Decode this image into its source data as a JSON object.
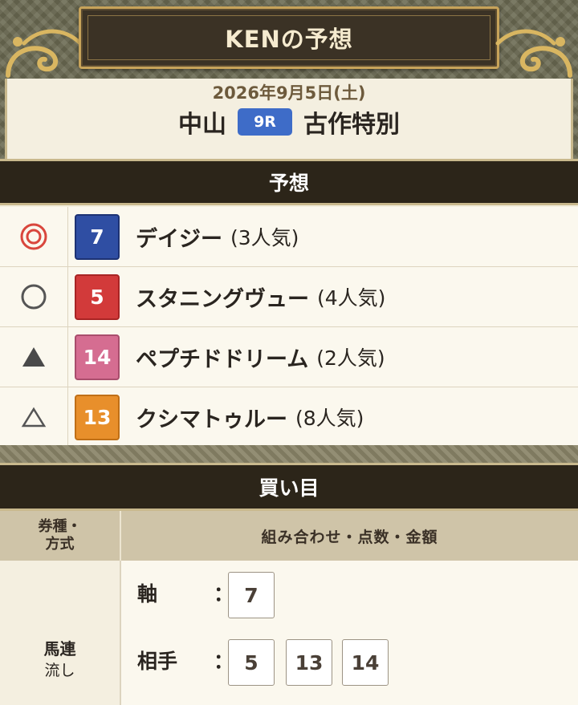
{
  "header": {
    "title": "KENの予想",
    "date": "2026年9月5日(土)",
    "venue": "中山",
    "race_number": "9R",
    "race_name": "古作特別"
  },
  "prediction": {
    "heading": "予想",
    "rows": [
      {
        "mark": "double-circle",
        "number": "7",
        "horse": "デイジー",
        "popularity": "(3人気)",
        "color": "#2f4ea3"
      },
      {
        "mark": "circle",
        "number": "5",
        "horse": "スタニングヴュー",
        "popularity": "(4人気)",
        "color": "#d23a3a"
      },
      {
        "mark": "filled-triangle",
        "number": "14",
        "horse": "ペプチドドリーム",
        "popularity": "(2人気)",
        "color": "#d56d91"
      },
      {
        "mark": "open-triangle",
        "number": "13",
        "horse": "クシマトゥルー",
        "popularity": "(8人気)",
        "color": "#e88f2b"
      }
    ]
  },
  "bets": {
    "heading": "買い目",
    "col1_header_line1": "券種・",
    "col1_header_line2": "方式",
    "col2_header": "組み合わせ・点数・金額",
    "bet_type": "馬連",
    "bet_method": "流し",
    "axis_label": "軸",
    "axis_numbers": [
      "7"
    ],
    "partner_label": "相手",
    "partner_numbers": [
      "5",
      "13",
      "14"
    ],
    "colon": "："
  }
}
